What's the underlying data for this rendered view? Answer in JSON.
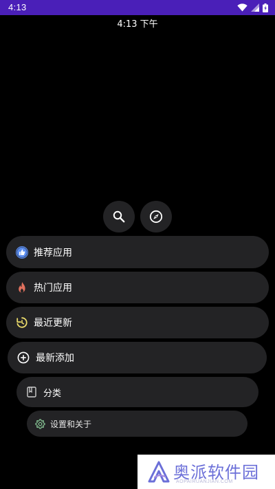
{
  "status_bar": {
    "time": "4:13",
    "icons": [
      "wifi-icon",
      "signal-icon",
      "battery-icon"
    ],
    "color": "#4a1fb8"
  },
  "clock": {
    "time": "4:13 下午"
  },
  "actions": [
    {
      "name": "search-button",
      "icon": "search-icon"
    },
    {
      "name": "explore-button",
      "icon": "compass-icon"
    }
  ],
  "menu": {
    "items": [
      {
        "label": "推荐应用",
        "icon": "thumbs-up-icon",
        "color": "#5b8def"
      },
      {
        "label": "热门应用",
        "icon": "flame-icon",
        "color": "#e0715e"
      },
      {
        "label": "最近更新",
        "icon": "refresh-icon",
        "color": "#e8d96a"
      },
      {
        "label": "最新添加",
        "icon": "add-circle-icon",
        "color": "#ffffff"
      },
      {
        "label": "分类",
        "icon": "book-icon",
        "color": "#cfcfcf"
      },
      {
        "label": "设置和关于",
        "icon": "gear-icon",
        "color": "#8fd19e"
      }
    ]
  },
  "watermark": {
    "text": "奥派软件园",
    "subtext": "AOPAIRUANJIAN.COM"
  }
}
